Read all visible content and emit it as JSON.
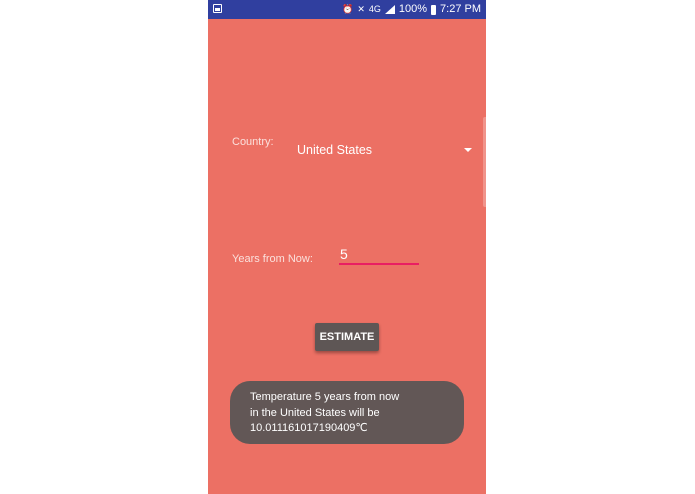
{
  "status_bar": {
    "battery_percent": "100%",
    "time": "7:27 PM",
    "network": "4G"
  },
  "form": {
    "country_label": "Country:",
    "country_value": "United States",
    "years_label": "Years from Now:",
    "years_value": "5",
    "estimate_button": "ESTIMATE"
  },
  "toast": {
    "line1": "Temperature 5 years from now",
    "line2": "in the United States will be",
    "line3": "10.011161017190409℃"
  },
  "colors": {
    "background": "#ec7064",
    "status_bar": "#303f9f",
    "input_underline": "#e91e63",
    "button": "#5e5655",
    "toast": "#625756"
  }
}
